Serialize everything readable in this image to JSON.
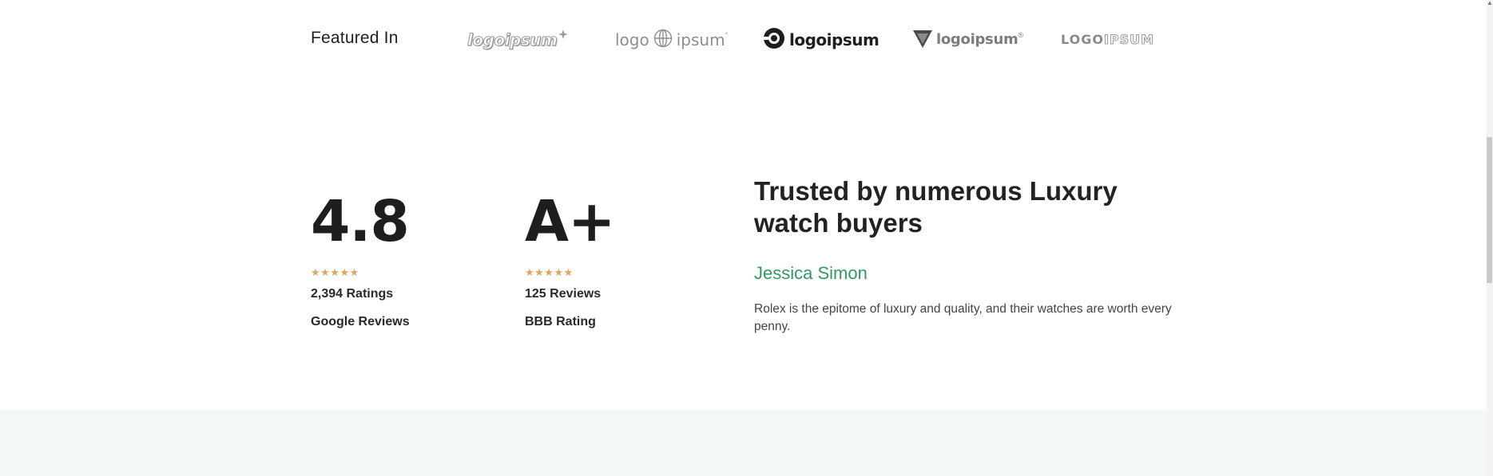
{
  "featured": {
    "title": "Featured In",
    "logos": [
      {
        "text": "logoipsum",
        "icon": "sparkle-logo-icon",
        "color": "#9a9a9a"
      },
      {
        "text_left": "logo",
        "text_right": "ipsum",
        "icon": "globe-logo-icon",
        "color": "#8e8e8e"
      },
      {
        "text": "logoipsum",
        "icon": "ring-logo-icon",
        "color": "#1e1e1e"
      },
      {
        "text": "logoipsum",
        "icon": "shield-logo-icon",
        "color": "#7d7d7d"
      },
      {
        "text_left": "LOGO",
        "text_right": "IPSUM",
        "icon": "wordmark-logo-icon",
        "color": "#8a8a8a"
      }
    ]
  },
  "stats": [
    {
      "value": "4.8",
      "stars": "★★★★★",
      "count": "2,394 Ratings",
      "source": "Google Reviews",
      "rating_stars": 5
    },
    {
      "value": "A+",
      "stars": "★★★★★",
      "count": "125 Reviews",
      "source": "BBB Rating",
      "rating_stars": 5
    }
  ],
  "testimonial": {
    "heading": "Trusted by numerous Luxury watch buyers",
    "name": "Jessica Simon",
    "quote": "Rolex is the epitome of luxury and quality, and their watches are worth every penny."
  },
  "colors": {
    "star": "#e0a45a",
    "name_accent": "#2f9a64",
    "band": "#f2f8f5"
  }
}
